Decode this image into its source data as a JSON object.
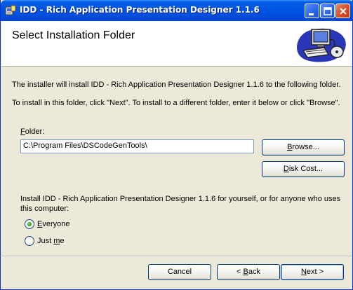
{
  "window": {
    "title": "IDD - Rich Application Presentation Designer 1.1.6",
    "title_bar_color": "#0054e3"
  },
  "header": {
    "title": "Select Installation Folder"
  },
  "body": {
    "line1": "The installer will install IDD - Rich Application Presentation Designer 1.1.6 to the following folder.",
    "line2": "To install in this folder, click \"Next\". To install to a different folder, enter it below or click \"Browse\"."
  },
  "folder": {
    "label_prefix": "",
    "label_accel": "F",
    "label_rest": "older:",
    "value": "C:\\Program Files\\DSCodeGenTools\\"
  },
  "buttons": {
    "browse_accel": "B",
    "browse_rest": "rowse...",
    "diskcost_accel": "D",
    "diskcost_rest": "isk Cost...",
    "cancel": "Cancel",
    "back_prefix": "< ",
    "back_accel": "B",
    "back_rest": "ack",
    "next_accel": "N",
    "next_rest": "ext >"
  },
  "install_for": {
    "description": "Install IDD - Rich Application Presentation Designer 1.1.6 for yourself, or for anyone who uses this computer:",
    "options": [
      {
        "accel": "E",
        "rest": "veryone",
        "selected": true
      },
      {
        "prefix": "Just ",
        "accel": "m",
        "rest": "e",
        "selected": false
      }
    ]
  }
}
